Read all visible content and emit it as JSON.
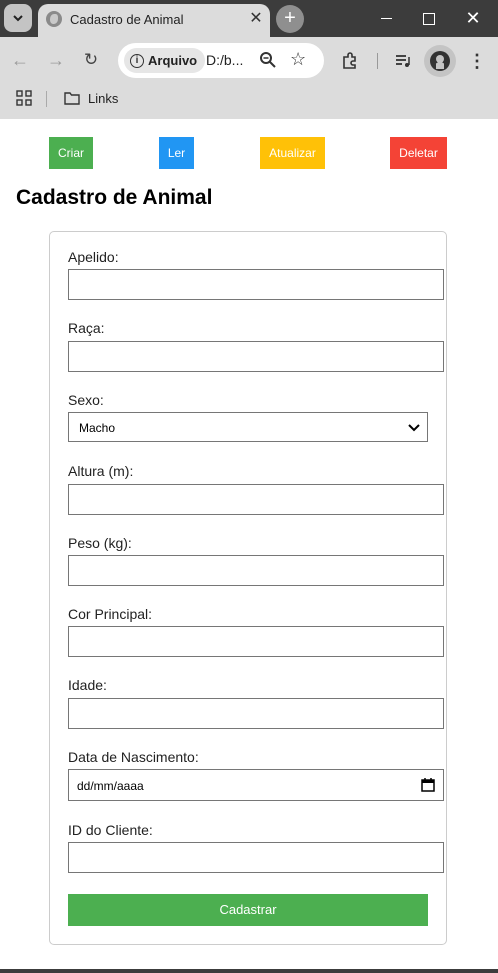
{
  "browser": {
    "tab_title": "Cadastro de Animal",
    "site_info_label": "Arquivo",
    "url": "D:/b...",
    "bookmarks": [
      {
        "label": "Links"
      }
    ]
  },
  "crud_buttons": [
    {
      "label": "Criar",
      "color": "#4caf50"
    },
    {
      "label": "Ler",
      "color": "#2196f3"
    },
    {
      "label": "Atualizar",
      "color": "#ffc107"
    },
    {
      "label": "Deletar",
      "color": "#f44336"
    }
  ],
  "page_title": "Cadastro de Animal",
  "form": {
    "fields": {
      "apelido": {
        "label": "Apelido:",
        "value": ""
      },
      "raca": {
        "label": "Raça:",
        "value": ""
      },
      "sexo": {
        "label": "Sexo:",
        "selected": "Macho"
      },
      "altura": {
        "label": "Altura (m):",
        "value": ""
      },
      "peso": {
        "label": "Peso (kg):",
        "value": ""
      },
      "cor_principal": {
        "label": "Cor Principal:",
        "value": ""
      },
      "idade": {
        "label": "Idade:",
        "value": ""
      },
      "data_nascimento": {
        "label": "Data de Nascimento:",
        "placeholder": "dd/mm/aaaa"
      },
      "id_cliente": {
        "label": "ID do Cliente:",
        "value": ""
      }
    },
    "submit_label": "Cadastrar",
    "submit_color": "#4caf50"
  }
}
